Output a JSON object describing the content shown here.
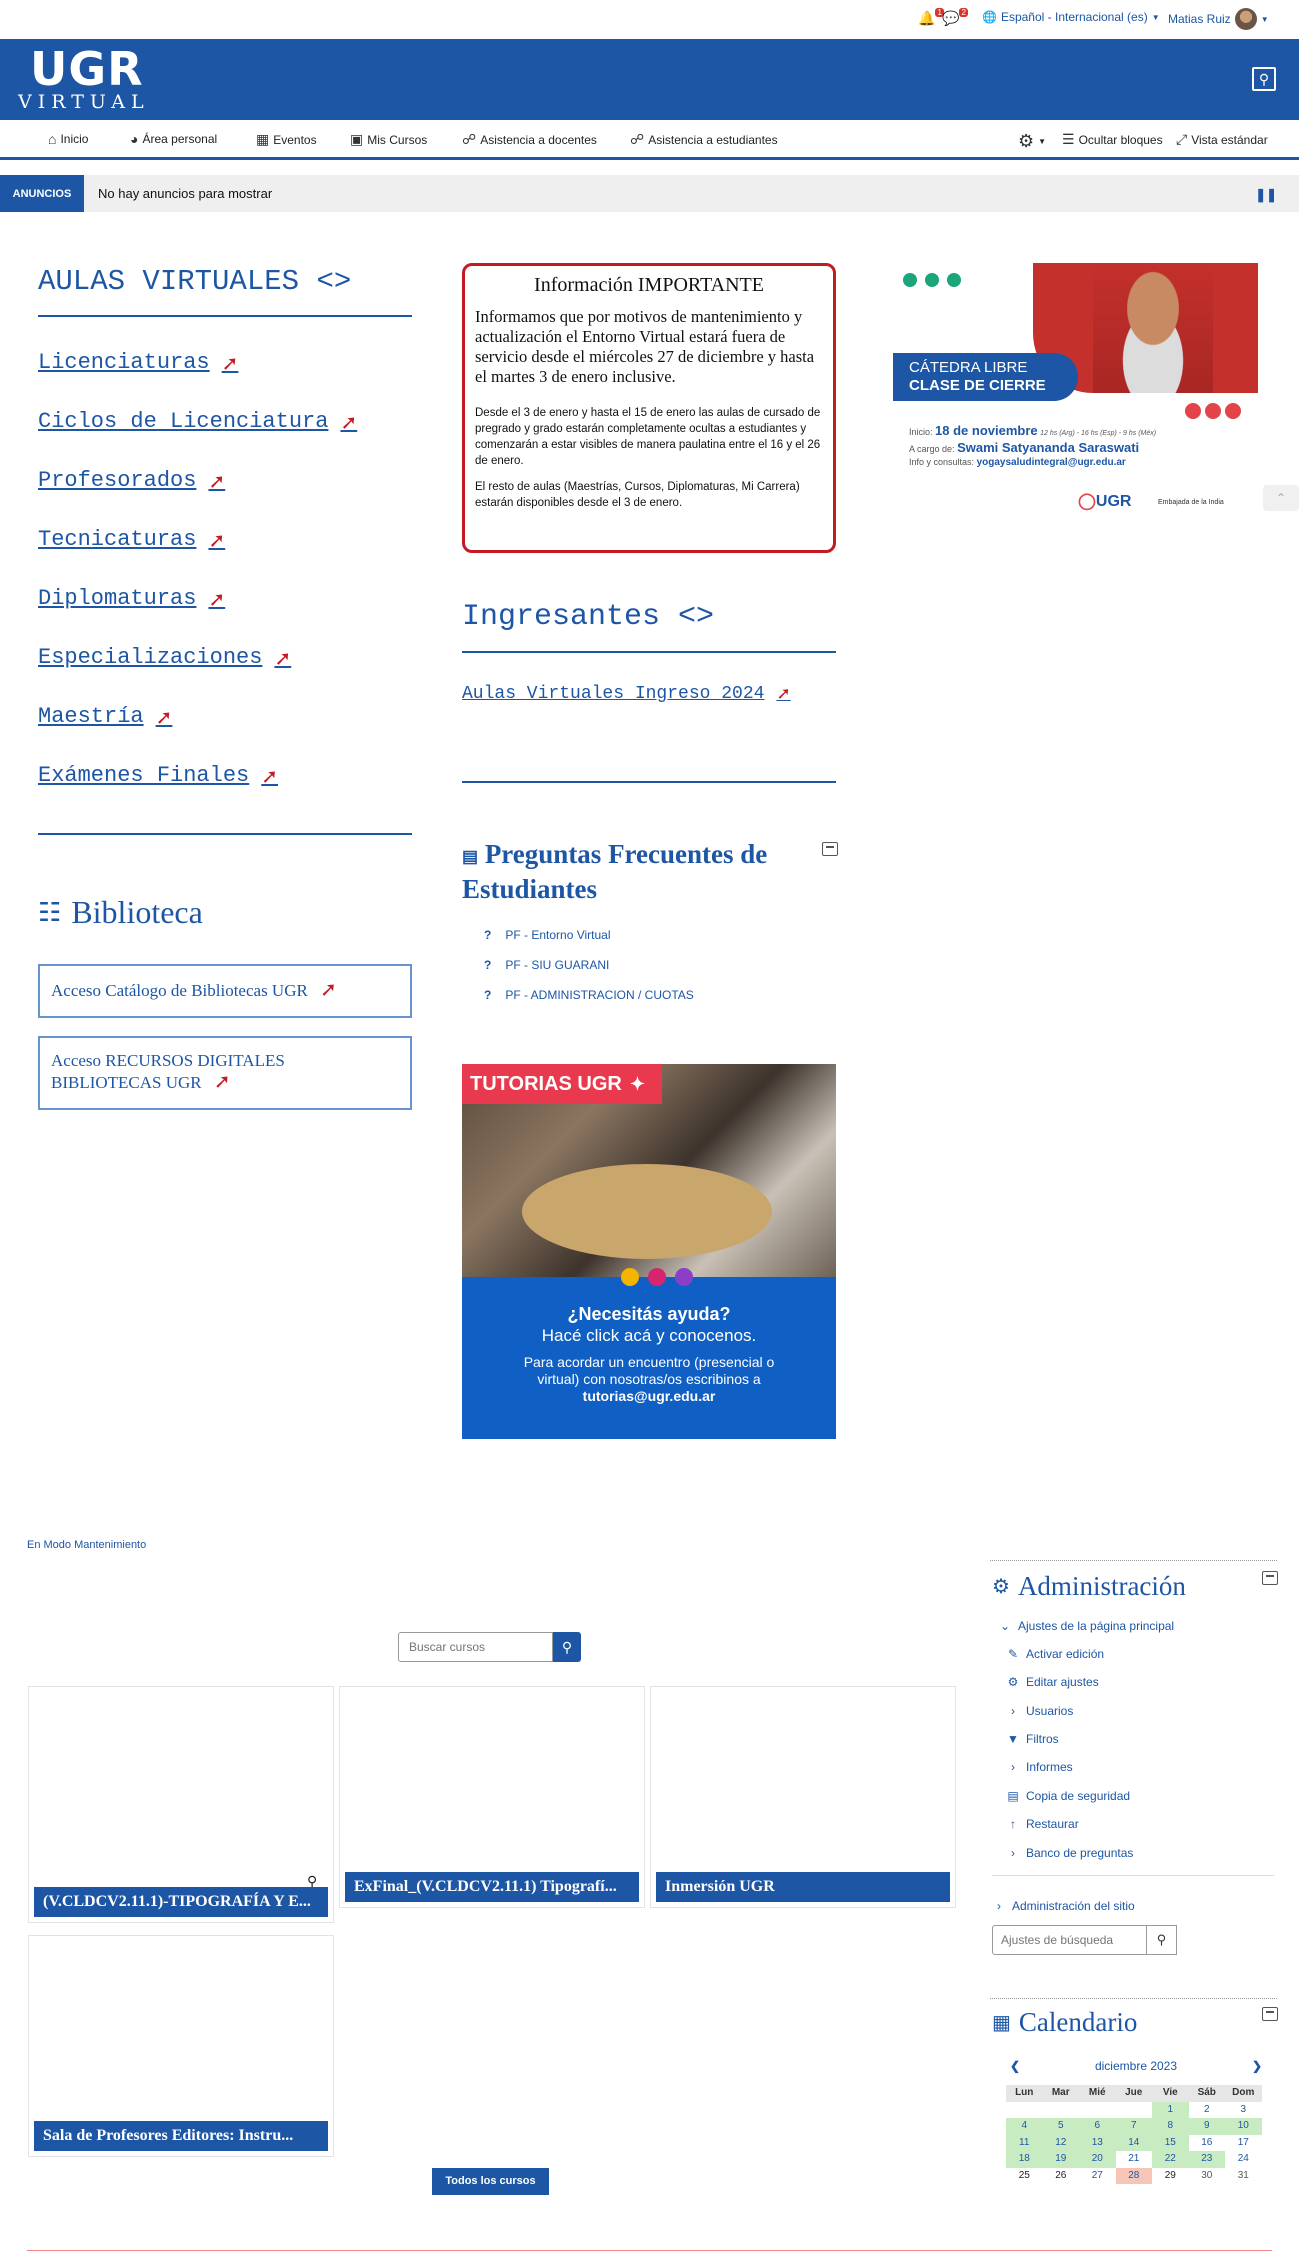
{
  "topbar": {
    "notif_count": "1",
    "msg_count": "2",
    "language": "Español - Internacional (es)",
    "user_name": "Matias Ruiz"
  },
  "header": {
    "logo_main": "UGR",
    "logo_sub": "VIRTUAL"
  },
  "nav": {
    "items": [
      "Inicio",
      "Área personal",
      "Eventos",
      "Mis Cursos",
      "Asistencia a docentes",
      "Asistencia a estudiantes"
    ],
    "hide_blocks": "Ocultar bloques",
    "standard_view": "Vista estándar"
  },
  "announcements": {
    "label": "ANUNCIOS",
    "text": "No hay anuncios para mostrar"
  },
  "aulas": {
    "title": "AULAS VIRTUALES <>",
    "links": [
      "Licenciaturas",
      "Ciclos de Licenciatura",
      "Profesorados",
      "Tecnicaturas",
      "Diplomaturas",
      "Especializaciones",
      "Maestría",
      "Exámenes Finales"
    ]
  },
  "biblioteca": {
    "title": "Biblioteca",
    "link1": "Acceso Catálogo de Bibliotecas UGR",
    "link2": "Acceso RECURSOS DIGITALES BIBLIOTECAS UGR"
  },
  "info": {
    "title": "Información IMPORTANTE",
    "p1": "Informamos que por motivos de mantenimiento y actualización el Entorno Virtual estará fuera de servicio desde el miércoles 27 de diciembre y hasta el martes 3 de enero inclusive.",
    "p2": "Desde el 3 de enero y hasta el 15 de enero las aulas de cursado de pregrado y grado estarán completamente ocultas a estudiantes y comenzarán a estar visibles de manera paulatina entre el 16 y el 26 de enero.",
    "p3": "El resto de aulas (Maestrías, Cursos, Diplomaturas, Mi Carrera) estarán disponibles desde el 3 de enero."
  },
  "ingresantes": {
    "title": "Ingresantes <>",
    "link": "Aulas Virtuales Ingreso 2024"
  },
  "faq": {
    "title": "Preguntas Frecuentes de Estudiantes",
    "items": [
      "PF - Entorno Virtual",
      "PF - SIU GUARANI",
      "PF - ADMINISTRACION / CUOTAS"
    ]
  },
  "tutorias": {
    "header": "TUTORIAS UGR",
    "line1": "¿Necesitás ayuda?",
    "line2": "Hacé click acá y conocenos.",
    "line3": "Para acordar un encuentro (presencial o",
    "line4": "virtual) con nosotras/os escribinos a",
    "email": "tutorias@ugr.edu.ar"
  },
  "poster": {
    "tag1": "CÁTEDRA LIBRE",
    "tag2": "CLASE DE CIERRE",
    "start_label": "Inicio:",
    "start_date": "18 de noviembre",
    "start_times": "12 hs (Arg) - 16 hs (Esp) - 9 hs (Méx)",
    "lead_label": "A cargo de:",
    "lead_name": "Swami Satyananda Saraswati",
    "contact_label": "Info y consultas:",
    "contact_email": "yogaysaludintegral@ugr.edu.ar",
    "logo": "UGR",
    "partner": "Embajada de la India"
  },
  "courses": {
    "maintenance": "En Modo Mantenimiento",
    "search_placeholder": "Buscar cursos",
    "cards": [
      "(V.CLDCV2.11.1)-TIPOGRAFÍA Y E...",
      "ExFinal_(V.CLDCV2.11.1) Tipografí...",
      "Inmersión UGR",
      "Sala de Profesores Editores: Instru..."
    ],
    "all_courses": "Todos los cursos"
  },
  "admin": {
    "title": "Administración",
    "front_settings": "Ajustes de la página principal",
    "items": [
      "Activar edición",
      "Editar ajustes",
      "Usuarios",
      "Filtros",
      "Informes",
      "Copia de seguridad",
      "Restaurar",
      "Banco de preguntas"
    ],
    "site_admin": "Administración del sitio",
    "search_placeholder": "Ajustes de búsqueda"
  },
  "calendar": {
    "title": "Calendario",
    "month": "diciembre 2023",
    "weekdays": [
      "Lun",
      "Mar",
      "Mié",
      "Jue",
      "Vie",
      "Sáb",
      "Dom"
    ],
    "weeks": [
      [
        "",
        "",
        "",
        "",
        "1",
        "2",
        "3"
      ],
      [
        "4",
        "5",
        "6",
        "7",
        "8",
        "9",
        "10"
      ],
      [
        "11",
        "12",
        "13",
        "14",
        "15",
        "16",
        "17"
      ],
      [
        "18",
        "19",
        "20",
        "21",
        "22",
        "23",
        "24"
      ],
      [
        "25",
        "26",
        "27",
        "28",
        "29",
        "30",
        "31"
      ]
    ]
  }
}
